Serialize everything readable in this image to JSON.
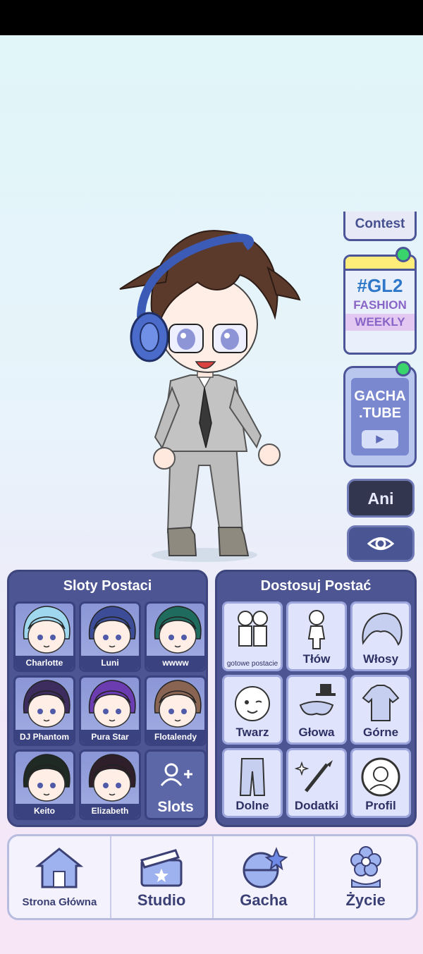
{
  "side": {
    "contest_label": "Contest",
    "gl2_title": "#GL2",
    "gl2_line1": "FASHION",
    "gl2_line2": "WEEKLY",
    "tube_line1": "GACHA",
    "tube_line2": ".TUBE",
    "ani_label": "Ani"
  },
  "slots": {
    "title": "Sloty Postaci",
    "items": [
      {
        "name": "Charlotte",
        "hair": "#9fd7ef"
      },
      {
        "name": "Luni",
        "hair": "#3d4c96"
      },
      {
        "name": "wwww",
        "hair": "#1f6b5e"
      },
      {
        "name": "DJ Phantom",
        "hair": "#3d2d5e"
      },
      {
        "name": "Pura Star",
        "hair": "#6b3bb0"
      },
      {
        "name": "Flotalendy",
        "hair": "#8a6452"
      },
      {
        "name": "Keito",
        "hair": "#1f2a24"
      },
      {
        "name": "Elizabeth",
        "hair": "#2e1f2a"
      }
    ],
    "add_label": "Slots"
  },
  "customize": {
    "title": "Dostosuj Postać",
    "items": [
      {
        "label": "gotowe postacie"
      },
      {
        "label": "Tłów"
      },
      {
        "label": "Włosy"
      },
      {
        "label": "Twarz"
      },
      {
        "label": "Głowa"
      },
      {
        "label": "Górne"
      },
      {
        "label": "Dolne"
      },
      {
        "label": "Dodatki"
      },
      {
        "label": "Profil"
      }
    ]
  },
  "nav": {
    "items": [
      {
        "label": "Strona Główna"
      },
      {
        "label": "Studio"
      },
      {
        "label": "Gacha"
      },
      {
        "label": "Życie"
      }
    ]
  }
}
